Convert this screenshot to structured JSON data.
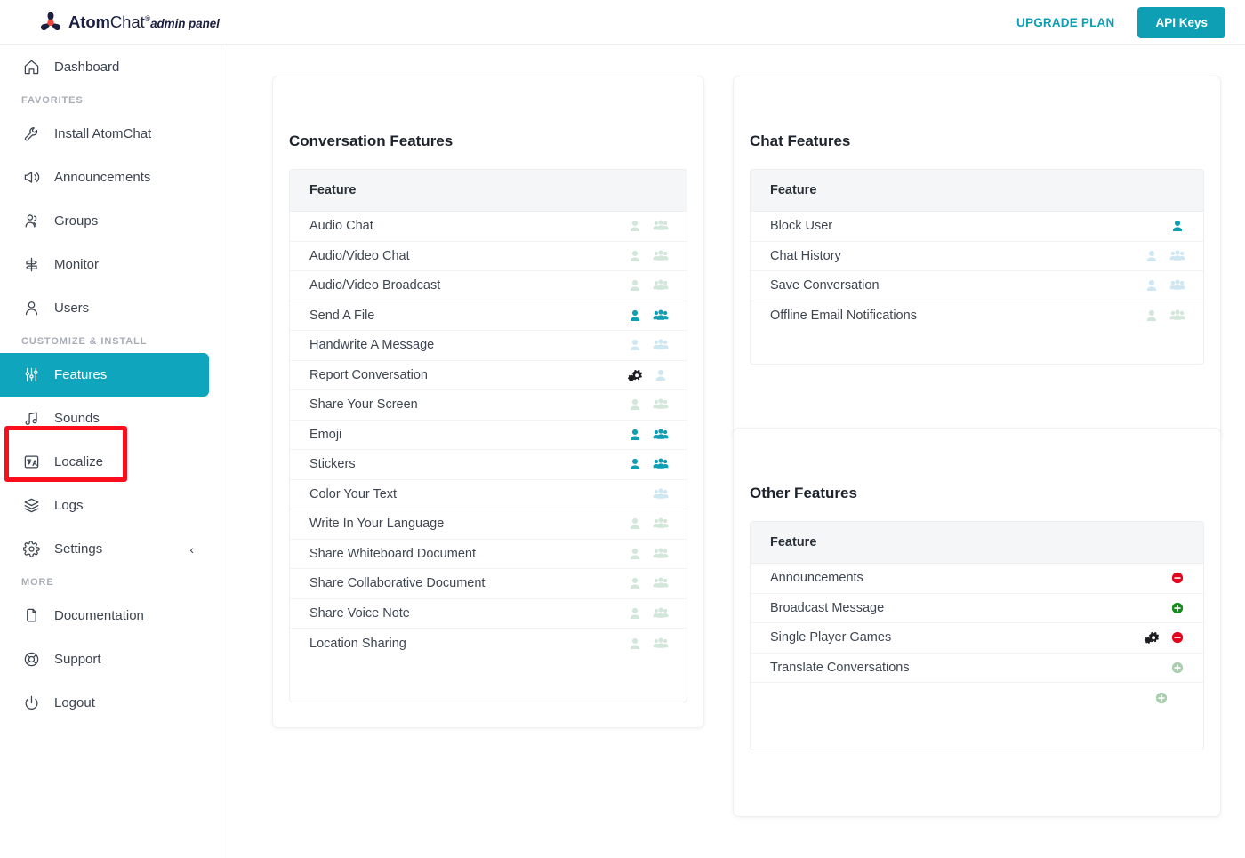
{
  "brand": {
    "name_bold": "Atom",
    "name_light": "Chat",
    "registered": "®",
    "subtitle": "admin panel",
    "logo_icon": "atom-logo-icon"
  },
  "header": {
    "upgrade_label": "UPGRADE PLAN",
    "api_keys_label": "API Keys",
    "accent_color": "#0e9fb5"
  },
  "sidebar": {
    "top": [
      {
        "label": "Dashboard",
        "icon": "home-icon",
        "active": false
      }
    ],
    "group_favorites_label": "FAVORITES",
    "favorites": [
      {
        "label": "Install AtomChat",
        "icon": "wrench-icon",
        "active": false
      },
      {
        "label": "Announcements",
        "icon": "megaphone-icon",
        "active": false
      },
      {
        "label": "Groups",
        "icon": "group-icon",
        "active": false
      },
      {
        "label": "Monitor",
        "icon": "signpost-icon",
        "active": false
      },
      {
        "label": "Users",
        "icon": "user-icon",
        "active": false
      }
    ],
    "group_customize_label": "CUSTOMIZE & INSTALL",
    "customize": [
      {
        "label": "Features",
        "icon": "sliders-icon",
        "active": true
      },
      {
        "label": "Sounds",
        "icon": "music-note-icon",
        "active": false
      },
      {
        "label": "Localize",
        "icon": "translate-icon",
        "active": false
      },
      {
        "label": "Logs",
        "icon": "layers-icon",
        "active": false
      },
      {
        "label": "Settings",
        "icon": "gear-icon",
        "active": false,
        "chevron": "‹"
      }
    ],
    "group_more_label": "MORE",
    "more": [
      {
        "label": "Documentation",
        "icon": "document-icon",
        "active": false
      },
      {
        "label": "Support",
        "icon": "lifebuoy-icon",
        "active": false
      },
      {
        "label": "Logout",
        "icon": "power-icon",
        "active": false
      }
    ],
    "active_color": "#0fa6bd",
    "annotation_color": "#fc0d1b"
  },
  "panels": {
    "conversation": {
      "title": "Conversation Features",
      "column_header": "Feature",
      "rows": [
        {
          "label": "Audio Chat",
          "icons": [
            "user-off-green",
            "group-off-green"
          ]
        },
        {
          "label": "Audio/Video Chat",
          "icons": [
            "user-off-green",
            "group-off-green"
          ]
        },
        {
          "label": "Audio/Video Broadcast",
          "icons": [
            "user-off-green",
            "group-off-green"
          ]
        },
        {
          "label": "Send A File",
          "icons": [
            "user-on",
            "group-on"
          ]
        },
        {
          "label": "Handwrite A Message",
          "icons": [
            "user-off-blue",
            "group-off-blue"
          ]
        },
        {
          "label": "Report Conversation",
          "icons": [
            "cogs-dark",
            "user-off-blue"
          ]
        },
        {
          "label": "Share Your Screen",
          "icons": [
            "user-off-green",
            "group-off-green"
          ]
        },
        {
          "label": "Emoji",
          "icons": [
            "user-on",
            "group-on"
          ]
        },
        {
          "label": "Stickers",
          "icons": [
            "user-on",
            "group-on"
          ]
        },
        {
          "label": "Color Your Text",
          "icons": [
            "group-off-blue"
          ]
        },
        {
          "label": "Write In Your Language",
          "icons": [
            "user-off-green",
            "group-off-green"
          ]
        },
        {
          "label": "Share Whiteboard Document",
          "icons": [
            "user-off-green",
            "group-off-green"
          ]
        },
        {
          "label": "Share Collaborative Document",
          "icons": [
            "user-off-green",
            "group-off-green"
          ]
        },
        {
          "label": "Share Voice Note",
          "icons": [
            "user-off-green",
            "group-off-green"
          ]
        },
        {
          "label": "Location Sharing",
          "icons": [
            "user-off-green",
            "group-off-green"
          ]
        }
      ]
    },
    "chat": {
      "title": "Chat Features",
      "column_header": "Feature",
      "rows": [
        {
          "label": "Block User",
          "icons": [
            "user-on"
          ]
        },
        {
          "label": "Chat History",
          "icons": [
            "user-off-blue",
            "group-off-blue"
          ]
        },
        {
          "label": "Save Conversation",
          "icons": [
            "user-off-blue",
            "group-off-blue"
          ]
        },
        {
          "label": "Offline Email Notifications",
          "icons": [
            "user-off-green",
            "group-off-green"
          ]
        }
      ]
    },
    "other": {
      "title": "Other Features",
      "column_header": "Feature",
      "rows": [
        {
          "label": "Announcements",
          "icons": [
            "minus-red"
          ]
        },
        {
          "label": "Broadcast Message",
          "icons": [
            "plus-green"
          ]
        },
        {
          "label": "Single Player Games",
          "icons": [
            "cogs-dark",
            "minus-red"
          ]
        },
        {
          "label": "Translate Conversations",
          "icons": [
            "plus-faded"
          ]
        },
        {
          "label": "",
          "icons": [
            "plus-faded-offset"
          ]
        }
      ]
    }
  },
  "colors": {
    "enabled_teal": "#0e9fb5",
    "disabled_green": "#d3e6da",
    "disabled_blue": "#cfe7f1",
    "minus_red": "#e3051b",
    "plus_green": "#168c1e",
    "plus_faded": "#a9cfae",
    "header_row_bg": "#f5f6f7"
  }
}
